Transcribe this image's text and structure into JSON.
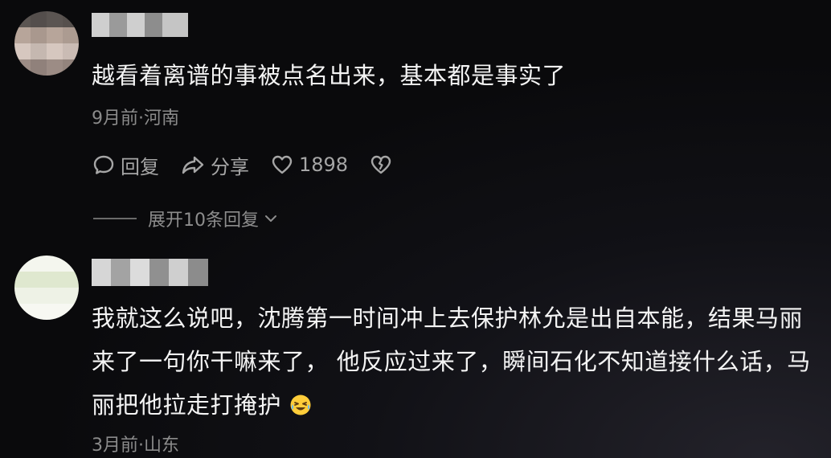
{
  "comments": [
    {
      "text": "越看着离谱的事被点名出来，基本都是事实了",
      "meta": "9月前·河南",
      "reply_label": "回复",
      "share_label": "分享",
      "like_count": "1898",
      "expand_label": "展开10条回复"
    },
    {
      "text": "我就这么说吧，沈腾第一时间冲上去保护林允是出自本能，结果马丽来了一句你干嘛来了， 他反应过来了，瞬间石化不知道接什么话，马丽把他拉走打掩护",
      "emoji": "laughing-crying-emoji",
      "meta": "3月前·山东"
    }
  ],
  "colors": {
    "text": "#f4f4f4",
    "meta": "#8b8b8b",
    "action": "#a6a6a6"
  }
}
